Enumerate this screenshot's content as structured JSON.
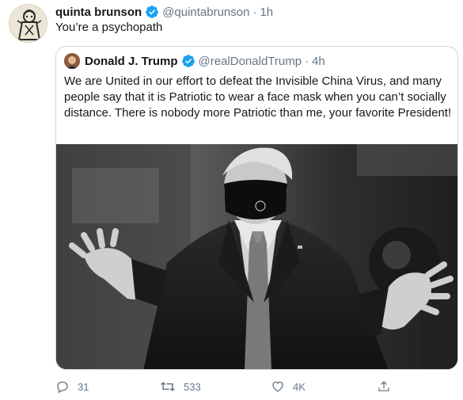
{
  "tweet": {
    "author_name": "quinta brunson",
    "author_handle": "@quintabrunson",
    "time": "1h",
    "separator": "·",
    "text": "You’re a psychopath",
    "avatar_icon": "avatar-illustration",
    "verified_icon": "verified-badge-icon",
    "accent_color": "#1da1f2"
  },
  "quoted": {
    "author_name": "Donald J. Trump",
    "author_handle": "@realDonaldTrump",
    "time": "4h",
    "separator": "·",
    "text": "We are United in our effort to defeat the Invisible China Virus, and many people say that it is Patriotic to wear a face mask when you can’t socially distance. There is nobody more Patriotic than me, your favorite President!",
    "photo": "black-and-white-photo-man-in-suit-wearing-face-mask"
  },
  "actions": {
    "reply_count": "31",
    "retweet_count": "533",
    "like_count": "4K",
    "reply_icon": "reply-icon",
    "retweet_icon": "retweet-icon",
    "like_icon": "heart-icon",
    "share_icon": "share-icon"
  }
}
